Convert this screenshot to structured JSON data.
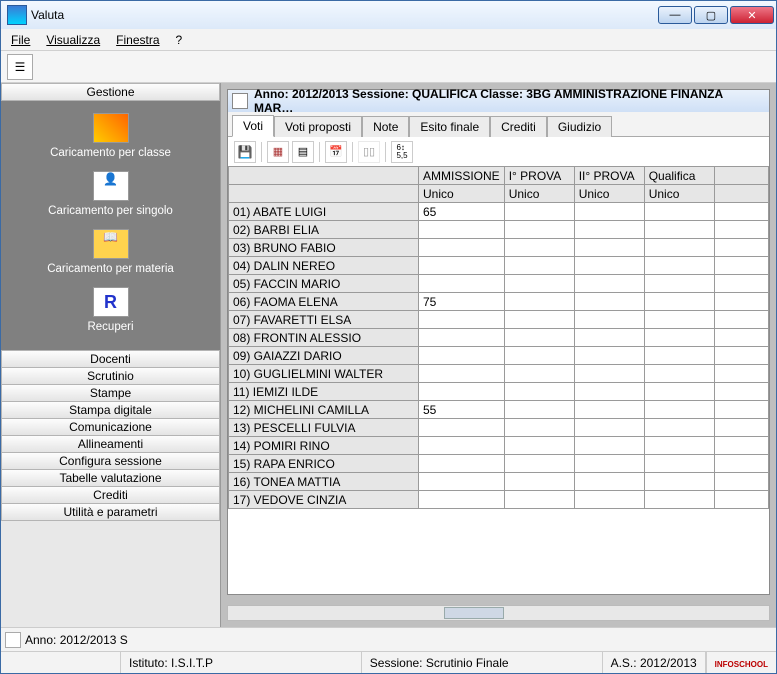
{
  "app_title": "Valuta",
  "menu": {
    "file": "File",
    "visualizza": "Visualizza",
    "finestra": "Finestra",
    "help": "?"
  },
  "sidebar": {
    "header": "Gestione",
    "items": [
      {
        "label": "Caricamento per classe"
      },
      {
        "label": "Caricamento per singolo"
      },
      {
        "label": "Caricamento per materia"
      },
      {
        "label": "Recuperi"
      }
    ],
    "accordion": [
      "Docenti",
      "Scrutinio",
      "Stampe",
      "Stampa digitale",
      "Comunicazione",
      "Allineamenti",
      "Configura sessione",
      "Tabelle valutazione",
      "Crediti",
      "Utilità e parametri"
    ]
  },
  "inner": {
    "title": "Anno: 2012/2013  Sessione: QUALIFICA   Classe: 3BG AMMINISTRAZIONE FINANZA MAR…",
    "tabs": [
      "Voti",
      "Voti proposti",
      "Note",
      "Esito finale",
      "Crediti",
      "Giudizio"
    ],
    "columns_top": [
      "",
      "AMMISSIONE",
      "I° PROVA",
      "II° PROVA",
      "Qualifica"
    ],
    "columns_sub": [
      "",
      "Unico",
      "Unico",
      "Unico",
      "Unico"
    ],
    "rows": [
      {
        "name": "01) ABATE LUIGI",
        "v": [
          "65",
          "",
          "",
          ""
        ]
      },
      {
        "name": "02) BARBI ELIA",
        "v": [
          "",
          "",
          "",
          ""
        ]
      },
      {
        "name": "03) BRUNO FABIO",
        "v": [
          "",
          "",
          "",
          ""
        ]
      },
      {
        "name": "04) DALIN NEREO",
        "v": [
          "",
          "",
          "",
          ""
        ]
      },
      {
        "name": "05) FACCIN MARIO",
        "v": [
          "",
          "",
          "",
          ""
        ]
      },
      {
        "name": "06) FAOMA ELENA",
        "v": [
          "75",
          "",
          "",
          ""
        ]
      },
      {
        "name": "07) FAVARETTI ELSA",
        "v": [
          "",
          "",
          "",
          ""
        ]
      },
      {
        "name": "08) FRONTIN ALESSIO",
        "v": [
          "",
          "",
          "",
          ""
        ]
      },
      {
        "name": "09) GAIAZZI DARIO",
        "v": [
          "",
          "",
          "",
          ""
        ]
      },
      {
        "name": "10) GUGLIELMINI WALTER",
        "v": [
          "",
          "",
          "",
          ""
        ]
      },
      {
        "name": "11) IEMIZI ILDE",
        "v": [
          "",
          "",
          "",
          ""
        ]
      },
      {
        "name": "12) MICHELINI CAMILLA",
        "v": [
          "55",
          "",
          "",
          ""
        ]
      },
      {
        "name": "13) PESCELLI FULVIA",
        "v": [
          "",
          "",
          "",
          ""
        ]
      },
      {
        "name": "14) POMIRI RINO",
        "v": [
          "",
          "",
          "",
          ""
        ]
      },
      {
        "name": "15) RAPA ENRICO",
        "v": [
          "",
          "",
          "",
          ""
        ]
      },
      {
        "name": "16) TONEA MATTIA",
        "v": [
          "",
          "",
          "",
          ""
        ]
      },
      {
        "name": "17) VEDOVE CINZIA",
        "v": [
          "",
          "",
          "",
          ""
        ]
      }
    ]
  },
  "status_short": "Anno: 2012/2013  S",
  "footer": {
    "istituto": "Istituto: I.S.I.T.P",
    "sessione": "Sessione: Scrutinio Finale",
    "anno": "A.S.: 2012/2013",
    "brand": "infoschool"
  }
}
